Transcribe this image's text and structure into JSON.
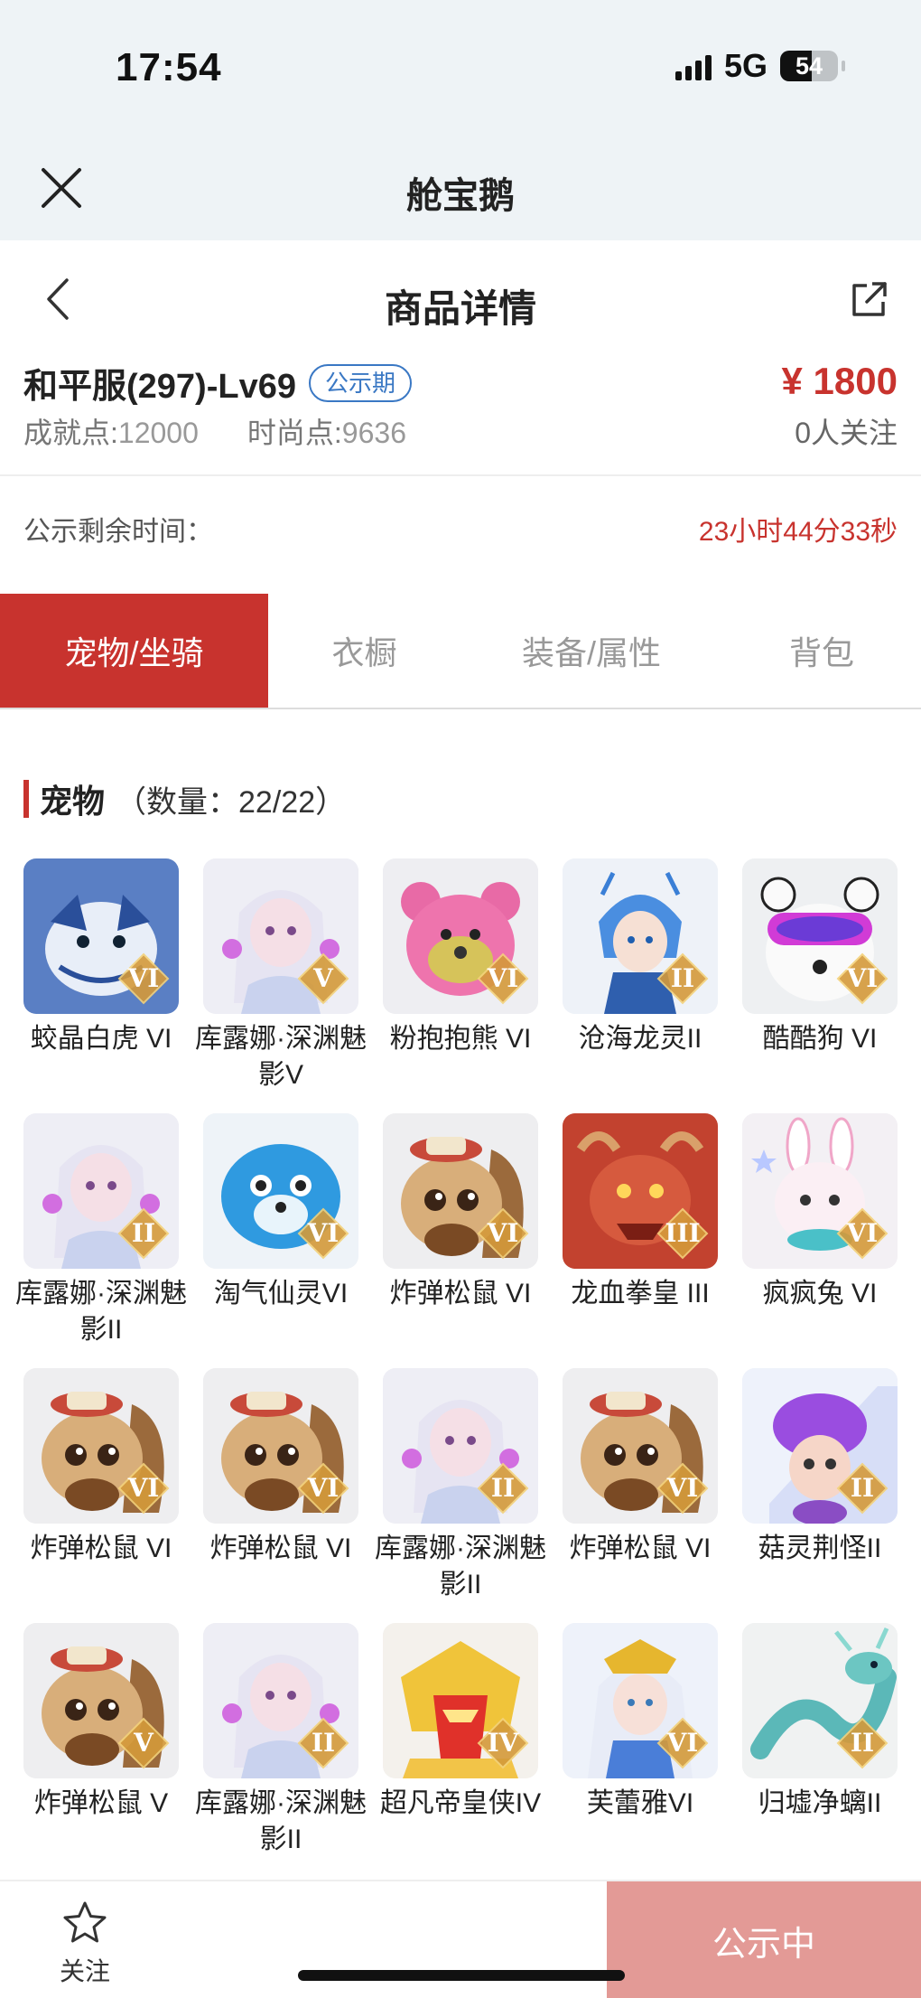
{
  "status_bar": {
    "time": "17:54",
    "network": "5G",
    "battery": "54",
    "battery_level": 0.54
  },
  "app_header": {
    "title": "舱宝鹅",
    "close_icon": "close-icon"
  },
  "page_header": {
    "title": "商品详情",
    "back_icon": "chevron-left-icon",
    "share_icon": "share-icon"
  },
  "product": {
    "name": "和平服(297)-Lv69",
    "badge": "公示期",
    "price": "¥ 1800",
    "achievement_label": "成就点:",
    "achievement_value": "12000",
    "fashion_label": "时尚点:",
    "fashion_value": "9636",
    "followers": "0人关注"
  },
  "remaining": {
    "label": "公示剩余时间：",
    "value": "23小时44分33秒"
  },
  "tabs": [
    {
      "label": "宠物/坐骑",
      "active": true
    },
    {
      "label": "衣橱",
      "active": false
    },
    {
      "label": "装备/属性",
      "active": false
    },
    {
      "label": "背包",
      "active": false
    }
  ],
  "section": {
    "title": "宠物",
    "count": "（数量：22/22）"
  },
  "pets": [
    {
      "name": "蛟晶白虎 VI",
      "rank": "VI",
      "kind": "tiger"
    },
    {
      "name": "库露娜·深渊魅影V",
      "rank": "V",
      "kind": "girl"
    },
    {
      "name": "粉抱抱熊 VI",
      "rank": "VI",
      "kind": "bear"
    },
    {
      "name": "沧海龙灵II",
      "rank": "II",
      "kind": "dragonboy"
    },
    {
      "name": "酷酷狗 VI",
      "rank": "VI",
      "kind": "dog"
    },
    {
      "name": "库露娜·深渊魅影II",
      "rank": "II",
      "kind": "girl"
    },
    {
      "name": "淘气仙灵VI",
      "rank": "VI",
      "kind": "bluepup"
    },
    {
      "name": "炸弹松鼠 VI",
      "rank": "VI",
      "kind": "squirrel"
    },
    {
      "name": "龙血拳皇 III",
      "rank": "III",
      "kind": "dragon"
    },
    {
      "name": "疯疯兔 VI",
      "rank": "VI",
      "kind": "rabbit"
    },
    {
      "name": "炸弹松鼠 VI",
      "rank": "VI",
      "kind": "squirrel"
    },
    {
      "name": "炸弹松鼠 VI",
      "rank": "VI",
      "kind": "squirrel"
    },
    {
      "name": "库露娜·深渊魅影II",
      "rank": "II",
      "kind": "girl"
    },
    {
      "name": "炸弹松鼠 VI",
      "rank": "VI",
      "kind": "squirrel"
    },
    {
      "name": "菇灵荆怪II",
      "rank": "II",
      "kind": "mushroom"
    },
    {
      "name": "炸弹松鼠 V",
      "rank": "V",
      "kind": "squirrel"
    },
    {
      "name": "库露娜·深渊魅影II",
      "rank": "II",
      "kind": "girl"
    },
    {
      "name": "超凡帝皇侠IV",
      "rank": "IV",
      "kind": "hero"
    },
    {
      "name": "芙蕾雅VI",
      "rank": "VI",
      "kind": "freya"
    },
    {
      "name": "归墟净螭II",
      "rank": "II",
      "kind": "chi"
    }
  ],
  "bottom_bar": {
    "follow_label": "关注",
    "follow_icon": "star-icon",
    "cta_label": "公示中"
  },
  "colors": {
    "accent": "#c8332e",
    "cta": "#e39a96",
    "badge": "#3a78c4",
    "header_bg": "#eef3f6"
  }
}
